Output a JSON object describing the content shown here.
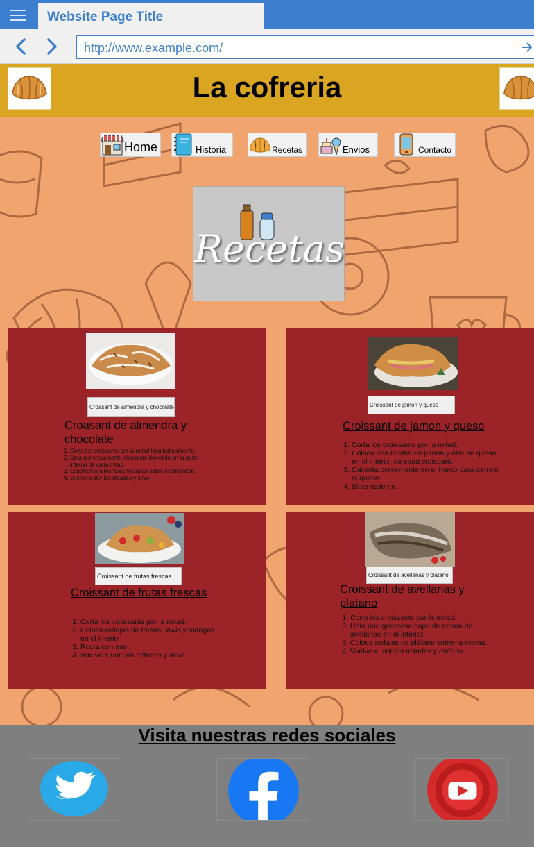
{
  "browser": {
    "tab_title": "Website Page Title",
    "url": "http://www.example.com/"
  },
  "header": {
    "site_title": "La cofreria"
  },
  "nav": [
    {
      "label": "Home",
      "icon": "bakery-shop-icon"
    },
    {
      "label": "Historia",
      "icon": "notebook-icon"
    },
    {
      "label": "Recetas",
      "icon": "croissant-icon"
    },
    {
      "label": "Envios",
      "icon": "cake-delivery-icon"
    },
    {
      "label": "Contacto",
      "icon": "phone-icon"
    }
  ],
  "hero": {
    "text": "Recetas",
    "icon": "salt-pepper-icon"
  },
  "recipes": [
    {
      "caption": "Croasant de almendra y chocolate",
      "title": "Croasant de almendra y chocolate",
      "steps": [
        "Corta los croissants por la mitad longitudinalmente.",
        "Unta generosamente chocolate derretido en la parte interna de cada mitad.",
        "Espolvorea almendras tostadas sobre el chocolate.",
        "Vuelve a unir las mitades y sirve."
      ]
    },
    {
      "caption": "Croissant de jamon y queso",
      "title": "Croissant de jamon y queso",
      "steps": [
        "Corta los croissants por la mitad.",
        "Coloca una loncha de jamón y otra de queso en el interior de cada croissant.",
        "Calienta brevemente en el horno para derretir el queso.",
        "Sirve caliente."
      ]
    },
    {
      "caption": "Croissant de frutas frescas",
      "title": "Croissant de frutas frescas",
      "steps": [
        "Corta los croissants por la mitad.",
        "Coloca rodajas de fresas, kiwis y mangos en el interior.",
        "Rocía con miel.",
        "Vuelve a unir las mitades y sirve."
      ]
    },
    {
      "caption": "Croissant de avellanas y platano",
      "title": "Croissant de avellanas y platano",
      "steps": [
        "Corta los croissants por la mitad.",
        "Unta una generosa capa de crema de avellanas en el interior.",
        "Coloca rodajas de plátano sobre la crema.",
        "Vuelve a unir las mitades y disfruta."
      ]
    }
  ],
  "footer": {
    "title": "Visita nuestras redes sociales",
    "social": [
      "twitter-icon",
      "facebook-icon",
      "youtube-icon"
    ]
  },
  "colors": {
    "browser_blue": "#3d7fcf",
    "header_gold": "#daa520",
    "background_peach": "#f2a46e",
    "card_red": "#9c2328",
    "footer_gray": "#7f7f7f"
  }
}
